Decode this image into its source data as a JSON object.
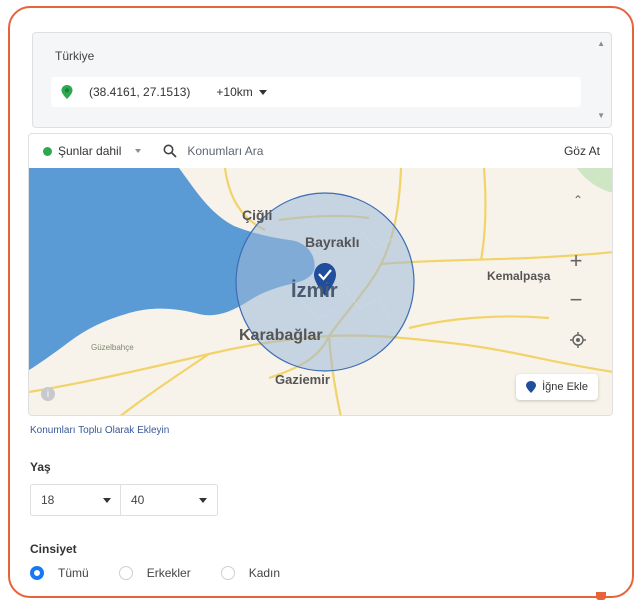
{
  "location": {
    "country": "Türkiye",
    "coordinates": "(38.4161, 27.1513)",
    "radius": "+10km"
  },
  "map_toolbar": {
    "include_label": "Şunlar dahil",
    "search_placeholder": "Konumları Ara",
    "browse_label": "Göz At"
  },
  "map": {
    "places": [
      "Çiğli",
      "Bayraklı",
      "İzmir",
      "Kemalpaşa",
      "Karabağlar",
      "Gaziemir",
      "Güzelbahçe"
    ],
    "drop_pin_label": "İğne Ekle",
    "water_color": "#5b9bd5",
    "radius_fill": "#9fb8d8"
  },
  "bulk_link": "Konumları Toplu Olarak Ekleyin",
  "age": {
    "title": "Yaş",
    "min": "18",
    "max": "40"
  },
  "gender": {
    "title": "Cinsiyet",
    "options": [
      "Tümü",
      "Erkekler",
      "Kadın"
    ],
    "selected": "Tümü"
  },
  "colors": {
    "frame": "#e8623a",
    "accent": "#1877f2",
    "include_dot": "#2ea84f"
  }
}
